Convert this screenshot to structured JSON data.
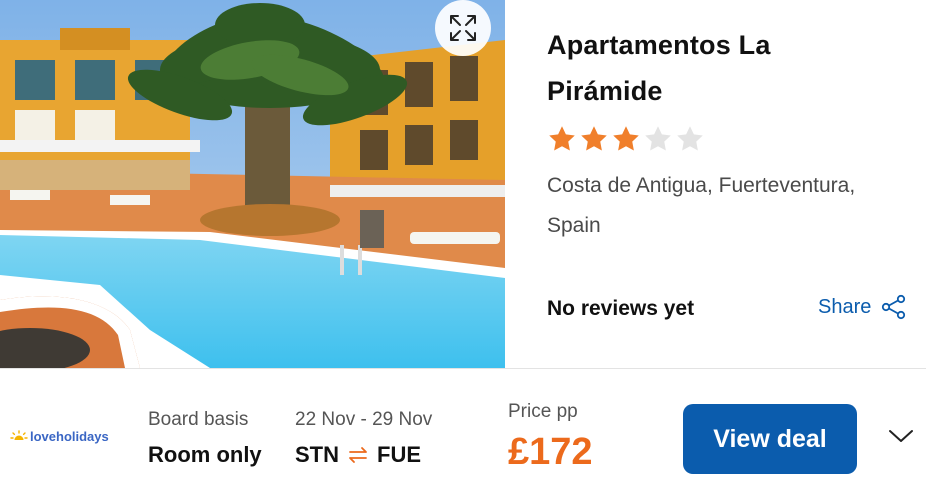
{
  "hotel": {
    "name_line1": "Apartamentos La",
    "name_line2": "Pirámide",
    "rating_stars": 3,
    "rating_max": 5,
    "location_line1": "Costa de Antigua, Fuerteventura,",
    "location_line2": "Spain",
    "reviews_text": "No reviews yet"
  },
  "actions": {
    "share_label": "Share",
    "expand_icon": "expand-icon",
    "share_icon": "share-icon"
  },
  "deal": {
    "provider": "loveholidays",
    "board_label": "Board basis",
    "board_value": "Room only",
    "dates": "22 Nov - 29 Nov",
    "origin": "STN",
    "destination": "FUE",
    "price_label": "Price pp",
    "price": "£172",
    "cta": "View deal"
  },
  "colors": {
    "accent_blue": "#0b5cad",
    "price_orange": "#ec6a1c",
    "star_filled": "#f07f2b",
    "star_empty": "#e3e3e3"
  }
}
